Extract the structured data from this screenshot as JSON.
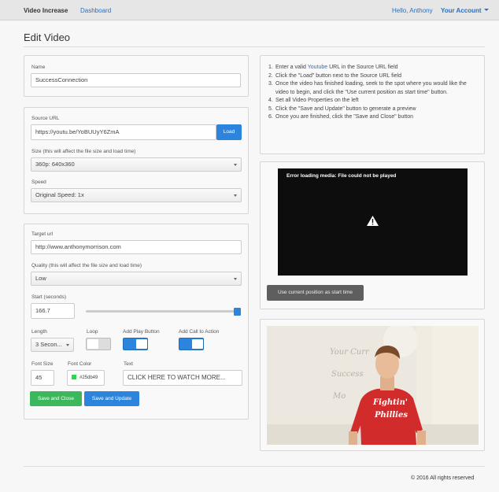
{
  "header": {
    "brand": "Video Increase",
    "nav_dashboard": "Dashboard",
    "greeting": "Hello, Anthony",
    "account": "Your Account"
  },
  "page": {
    "title": "Edit Video"
  },
  "name_panel": {
    "label": "Name",
    "value": "SuccessConnection"
  },
  "source_panel": {
    "source_label": "Source URL",
    "source_value": "https://youtu.be/YoBUUyY6ZmA",
    "load_button": "Load",
    "size_label": "Size (this will affect the file size and load time)",
    "size_value": "360p: 640x360",
    "speed_label": "Speed",
    "speed_value": "Original Speed: 1x"
  },
  "target_panel": {
    "target_label": "Target url",
    "target_value": "http://www.anthonymorrison.com",
    "quality_label": "Quality (this will affect the file size and load time)",
    "quality_value": "Low",
    "start_label": "Start (seconds)",
    "start_value": "166.7",
    "start_slider_fraction": 1.0,
    "length_label": "Length",
    "length_value": "3 Secon...",
    "loop_label": "Loop",
    "loop_on": false,
    "play_button_label": "Add Play Button",
    "play_button_on": true,
    "cta_label": "Add Call to Action",
    "cta_on": true,
    "font_size_label": "Font Size",
    "font_size_value": "45",
    "font_color_label": "Font Color",
    "font_color_value": "#25db49",
    "text_label": "Text",
    "text_value": "CLICK HERE TO WATCH MORE...",
    "save_close_button": "Save and Close",
    "save_update_button": "Save and Update"
  },
  "instructions": {
    "items": [
      {
        "num": "1.",
        "pre": "Enter a valid ",
        "link": "Youtube",
        "post": " URL in the Source URL field"
      },
      {
        "num": "2.",
        "pre": "Click the \"Load\" button next to the Source URL field",
        "link": "",
        "post": ""
      },
      {
        "num": "3.",
        "pre": "Once the video has finished loading, seek to the spot where you would like the video to begin, and click the \"Use current position as start time\" button.",
        "link": "",
        "post": ""
      },
      {
        "num": "4.",
        "pre": "Set all Video Properties on the left",
        "link": "",
        "post": ""
      },
      {
        "num": "5.",
        "pre": "Click the \"Save and Update\" button to generate a preview",
        "link": "",
        "post": ""
      },
      {
        "num": "6.",
        "pre": "Once you are finished, click the \"Save and Close\" button",
        "link": "",
        "post": ""
      }
    ]
  },
  "player": {
    "error": "Error loading media: File could not be played",
    "use_position_button": "Use current position as start time"
  },
  "thumbnail": {
    "shirt_line1": "Fightin'",
    "shirt_line2": "Phillies",
    "board_line1": "Your Curr",
    "board_line2": "Success",
    "board_line3": "Mo"
  },
  "footer": {
    "copyright": "© 2016 All rights reserved"
  },
  "colors": {
    "accent": "#2d84dd",
    "success": "#3bb85c",
    "link": "#2a6fc0",
    "font_color_swatch": "#25db49"
  }
}
